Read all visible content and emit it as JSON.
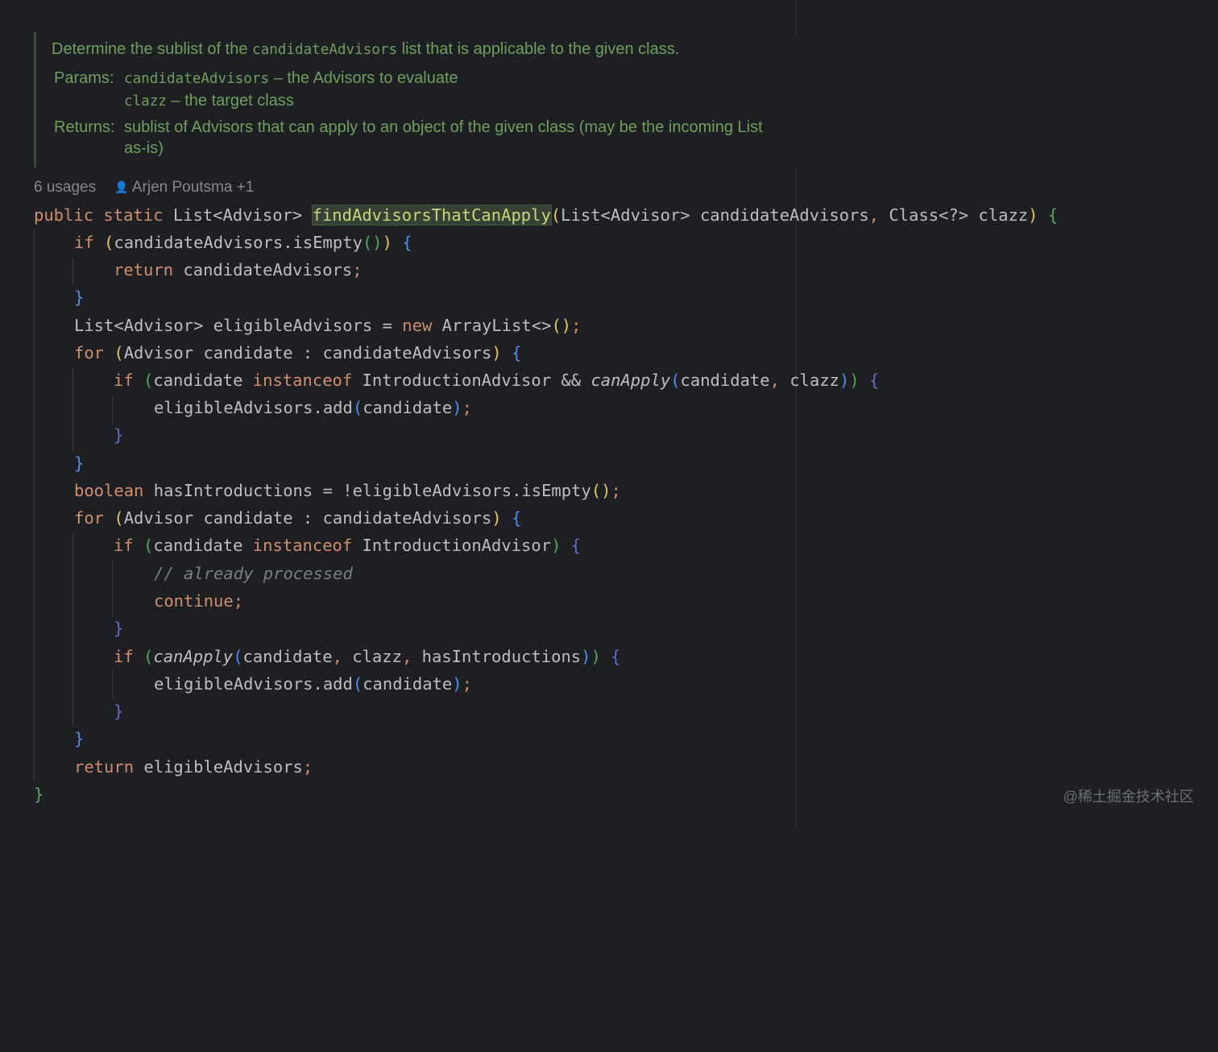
{
  "javadoc": {
    "summary_before": "Determine the sublist of the ",
    "summary_code": "candidateAdvisors",
    "summary_after": " list that is applicable to the given class.",
    "params_label": "Params:",
    "param1_name": "candidateAdvisors",
    "param1_desc": " – the Advisors to evaluate",
    "param2_name": "clazz",
    "param2_desc": " – the target class",
    "returns_label": "Returns:",
    "returns_line1": "sublist of Advisors that can apply to an object of the given class (may be the incoming List",
    "returns_line2": "as-is)"
  },
  "meta": {
    "usages": "6 usages",
    "author": "Arjen Poutsma +1"
  },
  "code": {
    "l1": {
      "kw_public": "public",
      "kw_static": "static",
      "ret_type": "List<Advisor>",
      "method": "findAdvisorsThatCanApply",
      "open": "(",
      "params": "List<Advisor> candidateAdvisors",
      "comma": ",",
      "param2": "Class<?> clazz",
      "close": ")",
      "brace": "{"
    },
    "l2": {
      "kw": "if",
      "open": "(",
      "expr": "candidateAdvisors.isEmpty",
      "call": "()",
      "close": ")",
      "brace": "{"
    },
    "l3": {
      "kw": "return",
      "expr": "candidateAdvisors",
      "semi": ";"
    },
    "l4": {
      "brace": "}"
    },
    "l5": {
      "decl": "List<Advisor> eligibleAdvisors = ",
      "kw": "new",
      "type": "ArrayList<>",
      "parens": "()",
      "semi": ";"
    },
    "l6": {
      "kw": "for",
      "open": "(",
      "expr": "Advisor candidate : candidateAdvisors",
      "close": ")",
      "brace": "{"
    },
    "l7": {
      "kw": "if",
      "open": "(",
      "a": "candidate ",
      "kw2": "instanceof",
      "b": " IntroductionAdvisor && ",
      "fn": "canApply",
      "popen": "(",
      "args1": "candidate",
      "comma": ",",
      "args2": "clazz",
      "pclose": ")",
      "close": ")",
      "brace": "{"
    },
    "l8": {
      "expr": "eligibleAdvisors.add",
      "open": "(",
      "arg": "candidate",
      "close": ")",
      "semi": ";"
    },
    "l9": {
      "brace": "}"
    },
    "l10": {
      "brace": "}"
    },
    "l11": {
      "kw": "boolean",
      "expr": "hasIntroductions = !eligibleAdvisors.isEmpty",
      "parens": "()",
      "semi": ";"
    },
    "l12": {
      "kw": "for",
      "open": "(",
      "expr": "Advisor candidate : candidateAdvisors",
      "close": ")",
      "brace": "{"
    },
    "l13": {
      "kw": "if",
      "open": "(",
      "a": "candidate ",
      "kw2": "instanceof",
      "b": " IntroductionAdvisor",
      "close": ")",
      "brace": "{"
    },
    "l14": {
      "comment": "// already processed"
    },
    "l15": {
      "kw": "continue",
      "semi": ";"
    },
    "l16": {
      "brace": "}"
    },
    "l17": {
      "kw": "if",
      "open": "(",
      "fn": "canApply",
      "popen": "(",
      "arg1": "candidate",
      "c1": ",",
      "arg2": "clazz",
      "c2": ",",
      "arg3": "hasIntroductions",
      "pclose": ")",
      "close": ")",
      "brace": "{"
    },
    "l18": {
      "expr": "eligibleAdvisors.add",
      "open": "(",
      "arg": "candidate",
      "close": ")",
      "semi": ";"
    },
    "l19": {
      "brace": "}"
    },
    "l20": {
      "brace": "}"
    },
    "l21": {
      "kw": "return",
      "expr": "eligibleAdvisors",
      "semi": ";"
    },
    "l22": {
      "brace": "}"
    }
  },
  "watermark": "@稀土掘金技术社区"
}
